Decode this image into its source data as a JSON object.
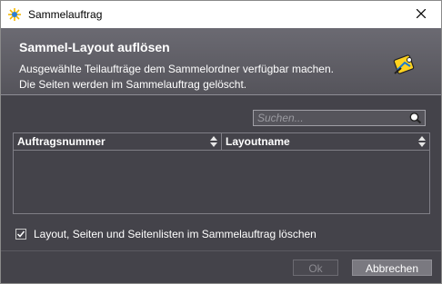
{
  "window": {
    "title": "Sammelauftrag",
    "app_icon": "star-burst-icon",
    "close_icon": "close-icon"
  },
  "header": {
    "title": "Sammel-Layout auflösen",
    "description_line1": "Ausgewählte Teilaufträge dem Sammelordner verfügbar machen.",
    "description_line2": "Die Seiten werden im Sammelauftrag gelöscht.",
    "icon": "wizard-icon"
  },
  "search": {
    "placeholder": "Suchen...",
    "value": "",
    "icon": "search-icon"
  },
  "table": {
    "columns": [
      "Auftragsnummer",
      "Layoutname"
    ],
    "rows": []
  },
  "option": {
    "checked": true,
    "label": "Layout, Seiten und Seitenlisten im Sammelauftrag löschen"
  },
  "buttons": {
    "ok": "Ok",
    "cancel": "Abbrechen"
  },
  "colors": {
    "background": "#44434a",
    "header": "#6b6a72",
    "accent": "#f2c200"
  }
}
